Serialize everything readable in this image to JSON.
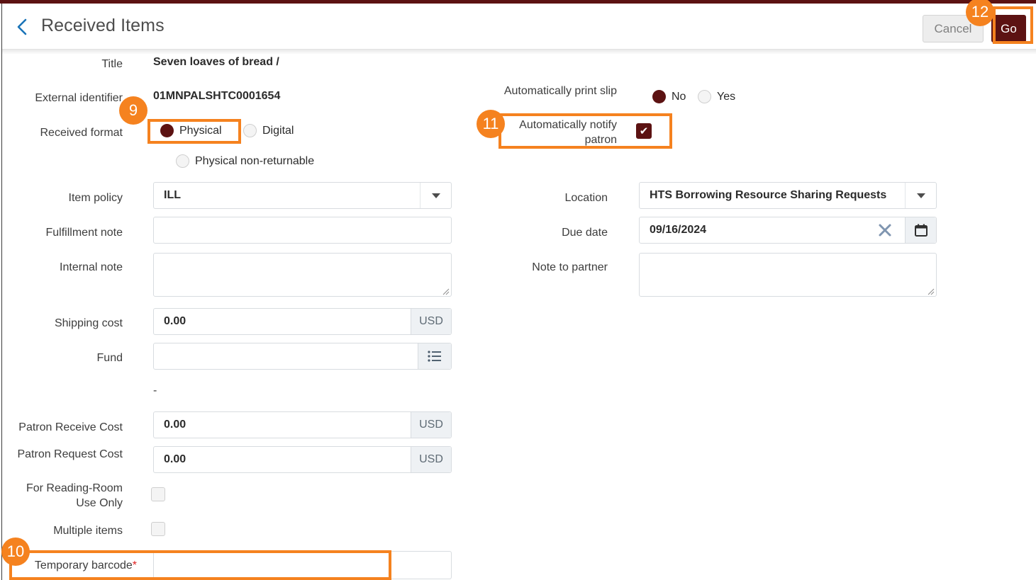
{
  "header": {
    "title": "Received Items",
    "back_icon": "chevron-left-icon",
    "cancel_label": "Cancel",
    "go_label": "Go"
  },
  "colors": {
    "accent_bar": "#5c1212",
    "primary_button": "#5c1212",
    "highlight": "#f5821f",
    "badge": "#f5821f",
    "required": "#e02020"
  },
  "callouts": [
    {
      "number": "9",
      "target": "received-format-physical"
    },
    {
      "number": "10",
      "target": "temporary-barcode"
    },
    {
      "number": "11",
      "target": "automatically-notify-patron"
    },
    {
      "number": "12",
      "target": "go-button"
    }
  ],
  "left_column": {
    "title": {
      "label": "Title",
      "value": "Seven loaves of bread /"
    },
    "external_identifier": {
      "label": "External identifier",
      "value": "01MNPALSHTC0001654"
    },
    "received_format": {
      "label": "Received format",
      "options": [
        {
          "label": "Physical",
          "selected": true
        },
        {
          "label": "Digital",
          "selected": false
        },
        {
          "label": "Physical non-returnable",
          "selected": false
        }
      ]
    },
    "item_policy": {
      "label": "Item policy",
      "value": "ILL",
      "icon": "chevron-down-icon"
    },
    "fulfillment_note": {
      "label": "Fulfillment note",
      "value": ""
    },
    "internal_note": {
      "label": "Internal note",
      "value": ""
    },
    "shipping_cost": {
      "label": "Shipping cost",
      "value": "0.00",
      "currency": "USD"
    },
    "fund": {
      "label": "Fund",
      "value": "",
      "icon": "list-icon"
    },
    "separator_dash": "-",
    "patron_receive_cost": {
      "label": "Patron Receive Cost",
      "value": "0.00",
      "currency": "USD"
    },
    "patron_request_cost": {
      "label": "Patron Request Cost",
      "value": "0.00",
      "currency": "USD"
    },
    "for_reading_room_use_only": {
      "label": "For Reading-Room Use Only",
      "checked": false
    },
    "multiple_items": {
      "label": "Multiple items",
      "checked": false
    },
    "temporary_barcode": {
      "label": "Temporary barcode",
      "required_mark": "*",
      "value": ""
    }
  },
  "right_column": {
    "automatically_print_slip": {
      "label": "Automatically print slip",
      "options": [
        {
          "label": "No",
          "selected": true
        },
        {
          "label": "Yes",
          "selected": false
        }
      ]
    },
    "automatically_notify_patron": {
      "label": "Automatically notify patron",
      "checked": true,
      "check_glyph": "✔"
    },
    "location": {
      "label": "Location",
      "value": "HTS Borrowing Resource Sharing Requests",
      "icon": "chevron-down-icon"
    },
    "due_date": {
      "label": "Due date",
      "value": "09/16/2024",
      "clear_icon": "close-x-icon",
      "calendar_icon": "calendar-icon"
    },
    "note_to_partner": {
      "label": "Note to partner",
      "value": ""
    }
  }
}
